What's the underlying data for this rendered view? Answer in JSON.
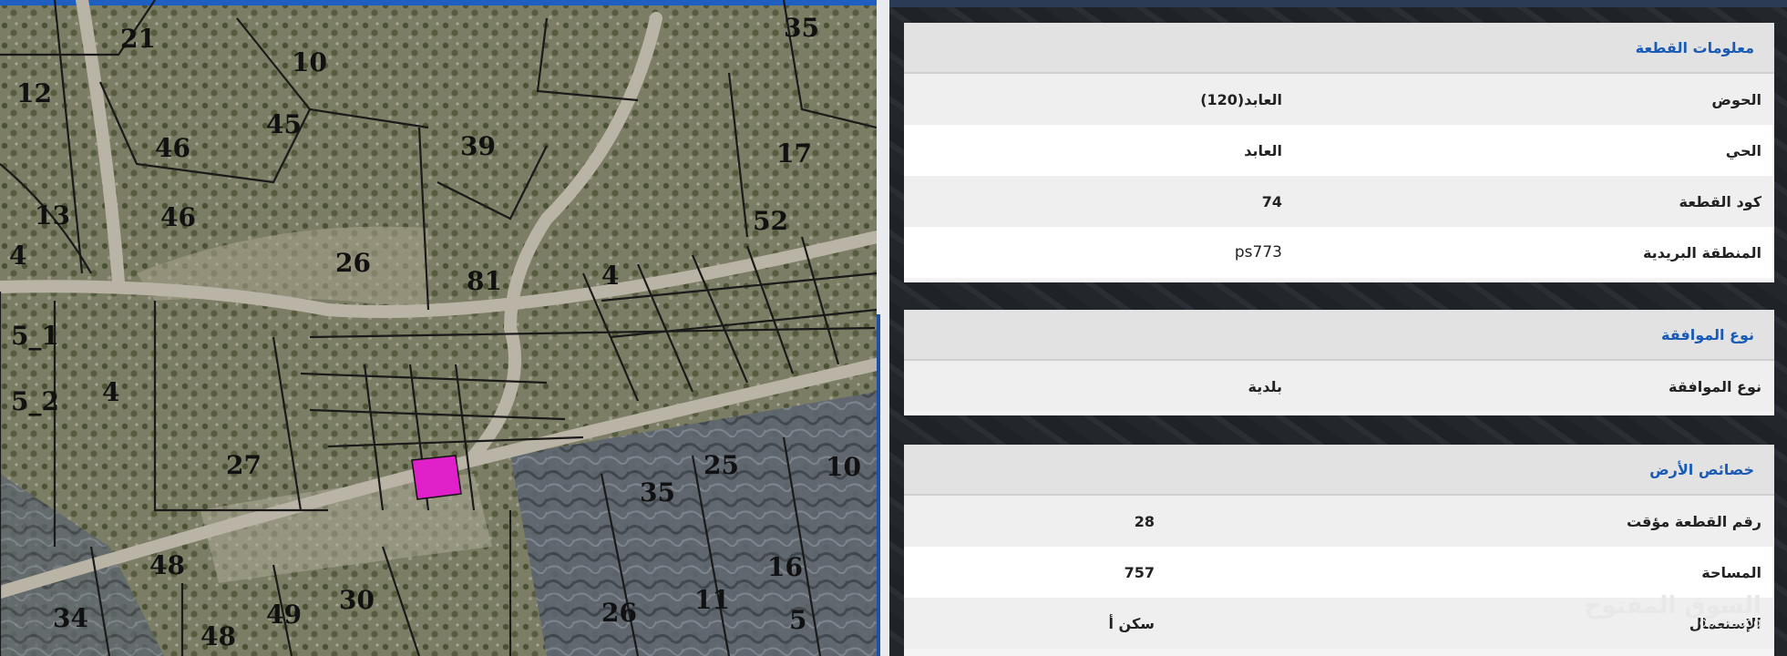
{
  "map": {
    "plot_numbers": [
      "35",
      "21",
      "10",
      "12",
      "45",
      "46",
      "39",
      "17",
      "46",
      "13",
      "52",
      "26",
      "81",
      "4",
      "4",
      "5_1",
      "5_2",
      "4",
      "27",
      "25",
      "10",
      "35",
      "48",
      "16",
      "11",
      "34",
      "49",
      "30",
      "26",
      "5",
      "48"
    ]
  },
  "panel": {
    "plot_info": {
      "title": "معلومات القطعة",
      "rows": [
        {
          "label": "الحوض",
          "value": "العابد(120)"
        },
        {
          "label": "الحي",
          "value": "العابد"
        },
        {
          "label": "كود القطعة",
          "value": "74"
        },
        {
          "label": "المنطقة البريدية",
          "value": "ps773"
        }
      ]
    },
    "approval": {
      "title": "نوع الموافقة",
      "rows": [
        {
          "label": "نوع الموافقة",
          "value": "بلدية"
        }
      ]
    },
    "land": {
      "title": "خصائص الأرض",
      "rows": [
        {
          "label": "رقم القطعة مؤقت",
          "value": "28"
        },
        {
          "label": "المساحة",
          "value": "757"
        },
        {
          "label": "الإستعمال",
          "value": "سكن أ"
        }
      ]
    },
    "watermark": {
      "arabic": "السوق المفتوح",
      "latin": "opensooq"
    }
  },
  "colors": {
    "highlight_plot": "#e020c8",
    "header_text": "#1a5bb5"
  }
}
